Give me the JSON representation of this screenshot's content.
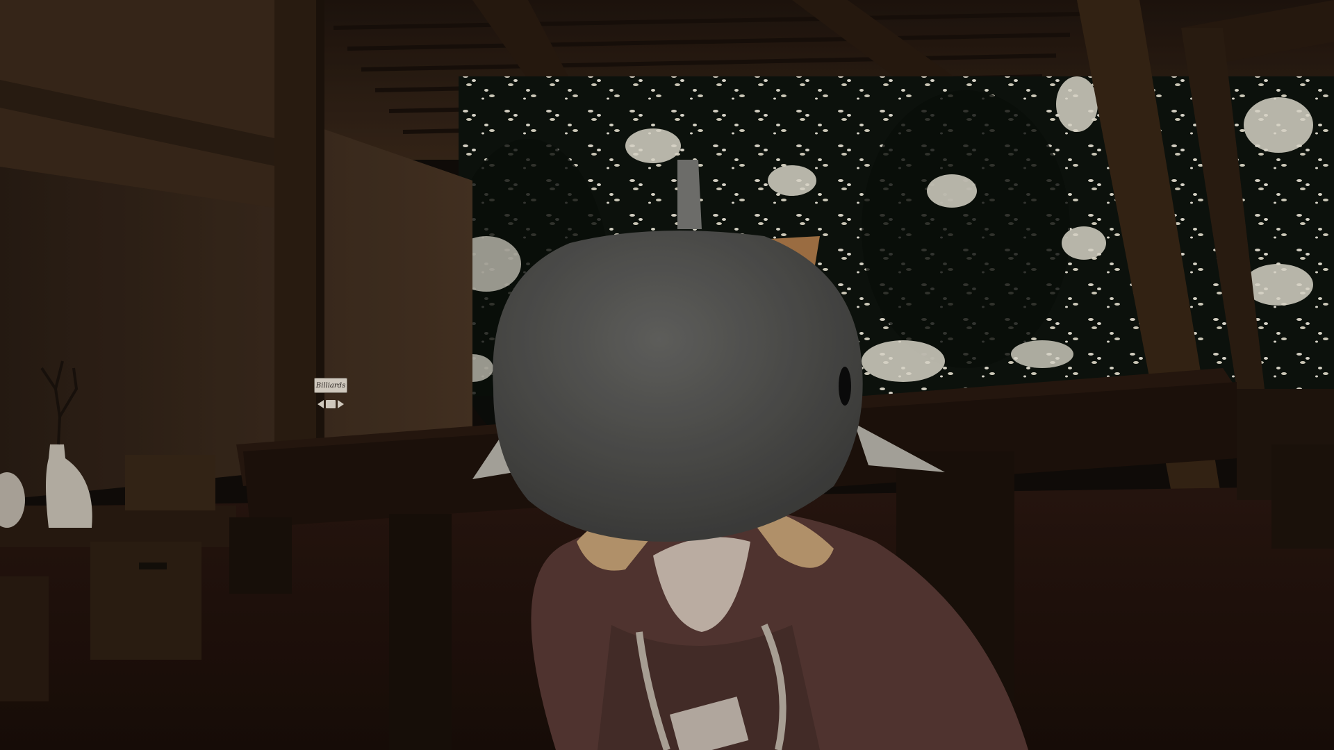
{
  "scene": {
    "world_sign": {
      "label": "Billiards",
      "left_arrow_icon": "arrow-left-icon",
      "right_arrow_icon": "arrow-right-icon"
    }
  },
  "colors": {
    "wood_dark": "#1c130d",
    "wood_mid": "#3a2818",
    "wall_left": "#3b2a1d",
    "foliage_bg": "#0d120d",
    "blossom": "#f2efe2",
    "shark_hat": "#5b5b59",
    "hoodie": "#5a3b36",
    "skin": "#d7c7bb",
    "hair": "#d7b07f"
  }
}
